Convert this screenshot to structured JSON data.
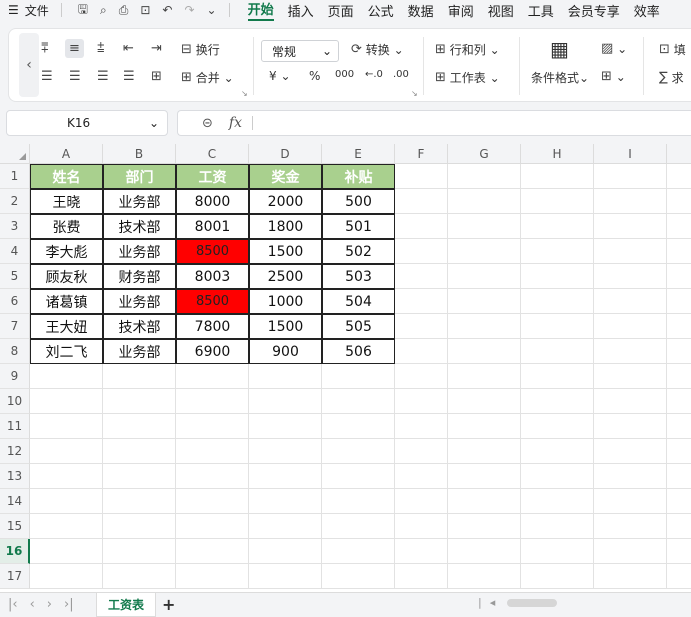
{
  "menubar": {
    "file_label": "文件",
    "tabs": [
      "开始",
      "插入",
      "页面",
      "公式",
      "数据",
      "审阅",
      "视图",
      "工具",
      "会员专享",
      "效率"
    ],
    "active_tab": "开始"
  },
  "ribbon": {
    "wrap_label": "换行",
    "merge_label": "合并",
    "number_format": "常规",
    "convert_label": "转换",
    "rowcol_label": "行和列",
    "worksheet_label": "工作表",
    "cond_format_label": "条件格式",
    "currency_symbol": "¥",
    "percent_symbol": "%",
    "thousands_symbol": "000",
    "fill_label": "填",
    "sum_label": "求"
  },
  "formula_bar": {
    "name_box": "K16",
    "fx_label": "fx",
    "formula_value": ""
  },
  "columns": [
    "A",
    "B",
    "C",
    "D",
    "E",
    "F",
    "G",
    "H",
    "I"
  ],
  "rows": [
    "1",
    "2",
    "3",
    "4",
    "5",
    "6",
    "7",
    "8",
    "9",
    "10",
    "11",
    "12",
    "13",
    "14",
    "15",
    "16",
    "17"
  ],
  "active_row": "16",
  "table": {
    "headers": [
      "姓名",
      "部门",
      "工资",
      "奖金",
      "补贴"
    ],
    "rows": [
      [
        "王晓",
        "业务部",
        "8000",
        "2000",
        "500"
      ],
      [
        "张费",
        "技术部",
        "8001",
        "1800",
        "501"
      ],
      [
        "李大彪",
        "业务部",
        "8500",
        "1500",
        "502"
      ],
      [
        "顾友秋",
        "财务部",
        "8003",
        "2500",
        "503"
      ],
      [
        "诸葛镇",
        "业务部",
        "8500",
        "1000",
        "504"
      ],
      [
        "王大妞",
        "技术部",
        "7800",
        "1500",
        "505"
      ],
      [
        "刘二飞",
        "业务部",
        "6900",
        "900",
        "506"
      ]
    ],
    "highlight_color": "#ff0000",
    "header_color": "#a9d08e",
    "highlighted_cells": [
      "C4",
      "C6"
    ]
  },
  "sheets": {
    "active": "工资表",
    "add_label": "+"
  },
  "colors": {
    "accent": "#127a4c"
  }
}
